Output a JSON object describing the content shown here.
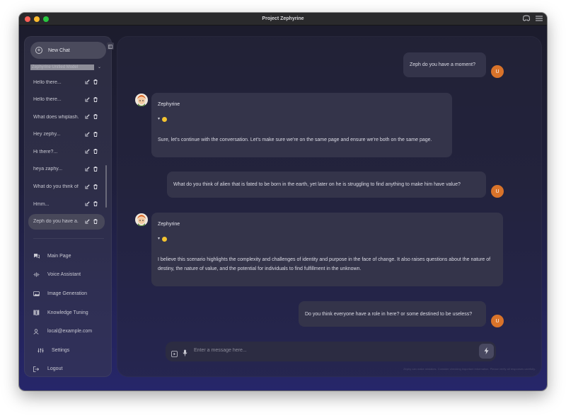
{
  "window": {
    "title": "Project Zephyrine"
  },
  "sidebar": {
    "new_chat_label": "New Chat",
    "model_select": "Zephyrine Unified Model",
    "chats": [
      {
        "label": "Hello there..."
      },
      {
        "label": "Hello there..."
      },
      {
        "label": "What does whiplash..."
      },
      {
        "label": "Hey zephy..."
      },
      {
        "label": "Hi there?..."
      },
      {
        "label": "heya zaphy..."
      },
      {
        "label": "What do you think of..."
      },
      {
        "label": "Hmm..."
      },
      {
        "label": "Zeph do you have a..."
      }
    ],
    "nav": {
      "main_page": "Main Page",
      "voice_assistant": "Voice Assistant",
      "image_generation": "Image Generation",
      "knowledge_tuning": "Knowledge Tuning",
      "account": "local@example.com",
      "settings": "Settings",
      "logout": "Logout"
    }
  },
  "conversation": {
    "user_initial": "U",
    "messages": [
      {
        "role": "user",
        "text": "Zeph do you have a moment?"
      },
      {
        "role": "assistant",
        "name": "Zephyrine",
        "text": "Sure, let's continue with the conversation. Let's make sure we're on the same page and ensure we're both on the same page."
      },
      {
        "role": "user",
        "text": "What do you think of alien that is fated to be born in the earth, yet later on he is struggling to find anything to make him have value?"
      },
      {
        "role": "assistant",
        "name": "Zephyrine",
        "text": "I believe this scenario highlights the complexity and challenges of identity and purpose in the face of change. It also raises questions about the nature of destiny, the nature of value, and the potential for individuals to find fulfillment in the unknown."
      },
      {
        "role": "user",
        "text": "Do you think everyone have a role in here? or some destined to be useless?"
      }
    ]
  },
  "composer": {
    "placeholder": "Enter a message here..."
  },
  "footer_note": "Zephy can make mistakes. Consider checking important information. Please verify all responses carefully.",
  "colors": {
    "accent": "#d9732a",
    "background": "#1f1f3c"
  }
}
